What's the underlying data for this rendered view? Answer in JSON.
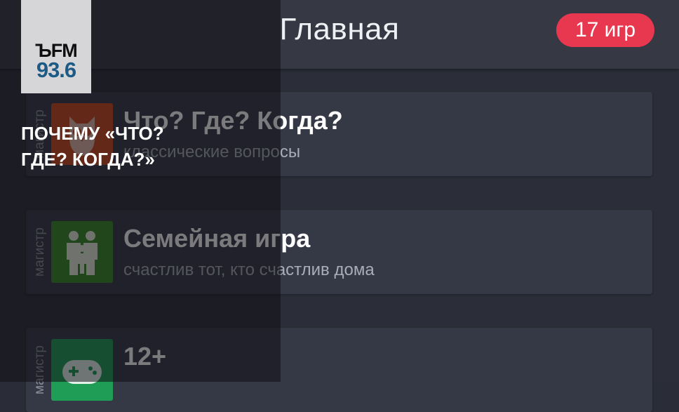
{
  "header": {
    "title": "Главная",
    "badge": "17 игр"
  },
  "games": [
    {
      "rank": "магистр",
      "title": "Что? Где? Когда?",
      "subtitle": "классические вопросы",
      "icon": "owl-icon",
      "icon_color": "#c9471d"
    },
    {
      "rank": "магистр",
      "title": "Семейная игра",
      "subtitle": "счастлив тот, кто счастлив дома",
      "icon": "family-icon",
      "icon_color": "#3a8a24"
    },
    {
      "rank": "магистр",
      "title": "12+",
      "subtitle": "",
      "icon": "gamepad-icon",
      "icon_color": "#1f9c56"
    }
  ],
  "overlay": {
    "logo_top": "ЪFM",
    "logo_number": "93.6",
    "headline_line1": "ПОЧЕМУ «ЧТО?",
    "headline_line2": "ГДЕ? КОГДА?»"
  },
  "colors": {
    "badge": "#e8384f",
    "background": "#2b2e38",
    "card": "#353845",
    "logo_blue": "#1d5a86"
  }
}
